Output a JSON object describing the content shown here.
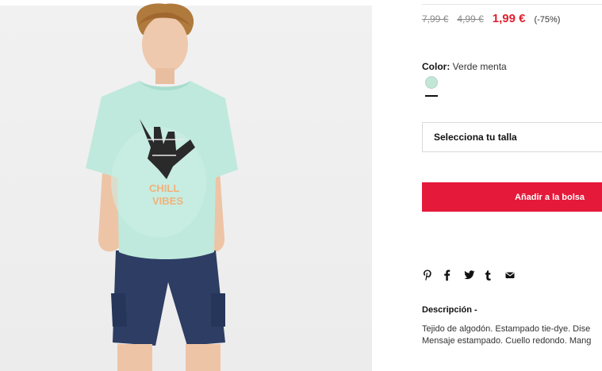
{
  "product": {
    "image_alt": "Niño con camiseta verde menta tie-dye y bermudas azul marino",
    "prices": {
      "original": "7,99 €",
      "previous": "4,99 €",
      "current": "1,99 €",
      "discount": "(-75%)"
    },
    "color": {
      "label": "Color:",
      "value": "Verde menta",
      "swatch_hex": "#c3e6d6"
    },
    "size_select": {
      "placeholder": "Selecciona tu talla"
    },
    "add_to_bag_label": "Añadir a la bolsa",
    "share_icons": [
      "pinterest-icon",
      "facebook-icon",
      "twitter-icon",
      "tumblr-icon",
      "email-icon"
    ],
    "description": {
      "title": "Descripción -",
      "lines": [
        "Tejido de algodón. Estampado tie-dye. Dise",
        "Mensaje estampado. Cuello redondo. Mang"
      ]
    }
  },
  "colors": {
    "accent": "#e5193a",
    "sale_price": "#e1202e"
  }
}
